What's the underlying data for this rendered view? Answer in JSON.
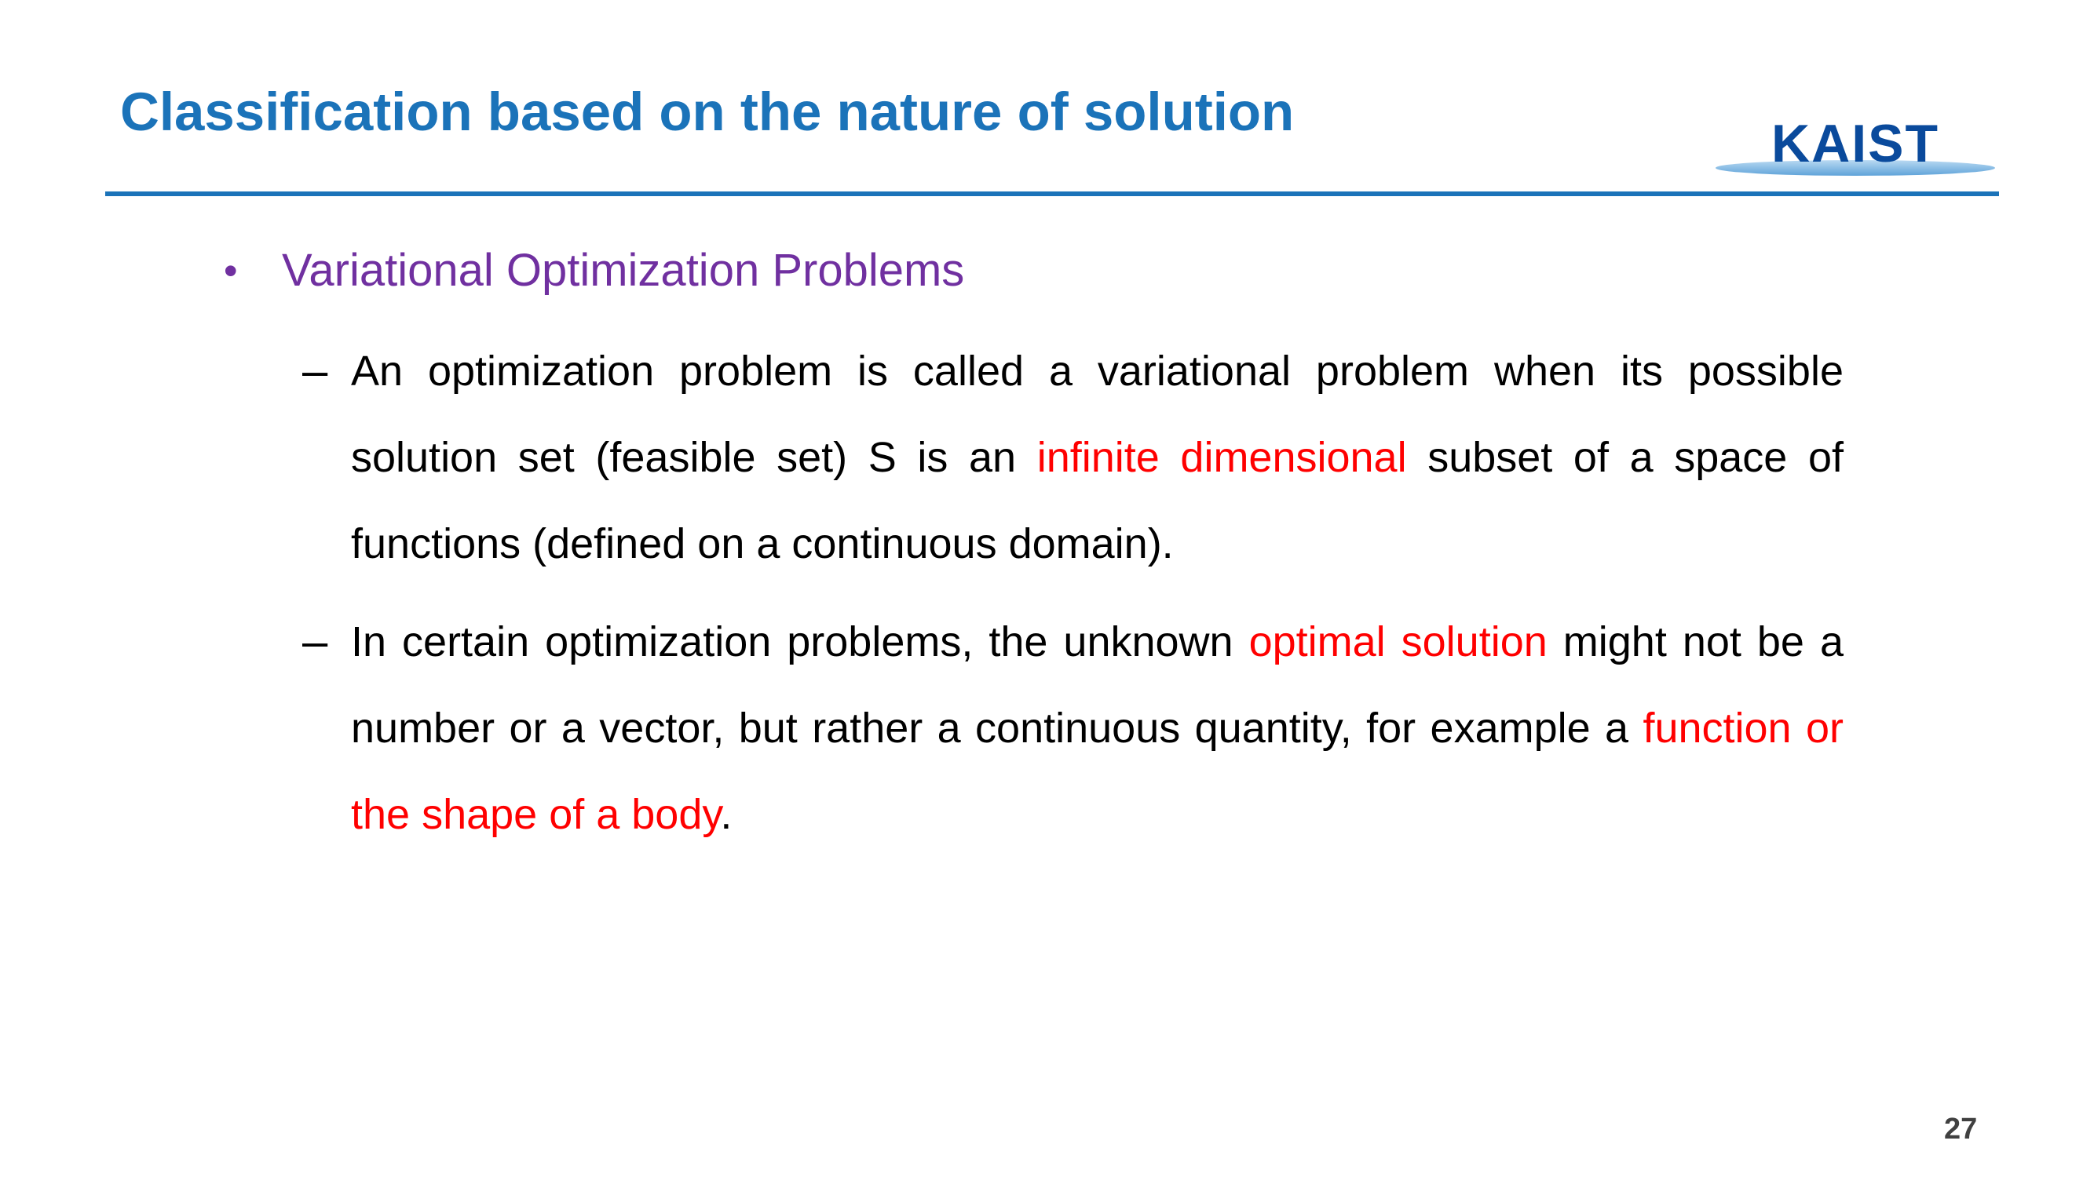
{
  "slide": {
    "title": "Classification based on the nature of solution",
    "logo_text": "KAIST",
    "bullet": "Variational Optimization Problems",
    "item1": {
      "part1": "An optimization problem is called a variational problem when its possible solution set (feasible set) S is an ",
      "highlight": "infinite dimensional",
      "part2": " subset of a space of functions (defined on a continuous domain)."
    },
    "item2": {
      "part1": "In certain optimization problems, the unknown ",
      "highlight1": "optimal solution",
      "part2": " might not be a number or a vector, but rather a continuous quantity, for example a ",
      "highlight2": "function or the shape of a body",
      "part3": "."
    },
    "dash_symbol": "–",
    "bullet_symbol": "•",
    "page_number": "27"
  },
  "colors": {
    "title": "#1b73b9",
    "bullet": "#7030a0",
    "highlight": "#ff0000",
    "body": "#000000"
  }
}
